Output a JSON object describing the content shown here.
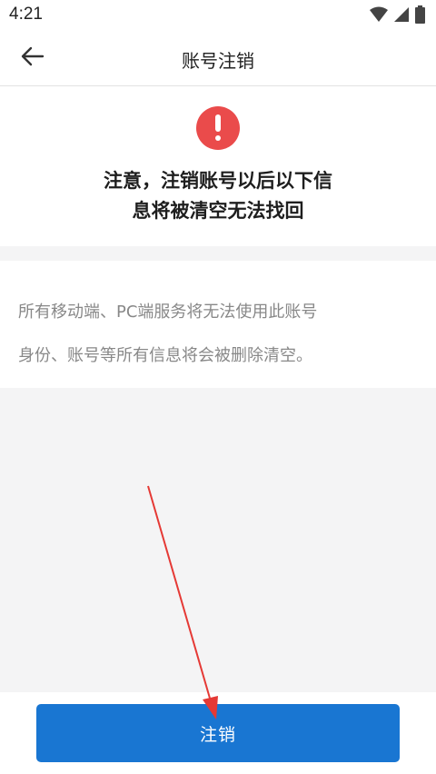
{
  "status_bar": {
    "time": "4:21"
  },
  "app_bar": {
    "back_icon": "arrow-left-icon",
    "title": "账号注销"
  },
  "warning": {
    "icon": "exclamation-circle-icon",
    "icon_color": "#ea4b4b",
    "line1": "注意，注销账号以后以下信",
    "line2": "息将被清空无法找回"
  },
  "info": {
    "line1": "所有移动端、PC端服务将无法使用此账号",
    "line2": "身份、账号等所有信息将会被删除清空。"
  },
  "action": {
    "button_label": "注销",
    "button_color": "#1976d2"
  },
  "annotation": {
    "arrow_color": "#e53935"
  }
}
